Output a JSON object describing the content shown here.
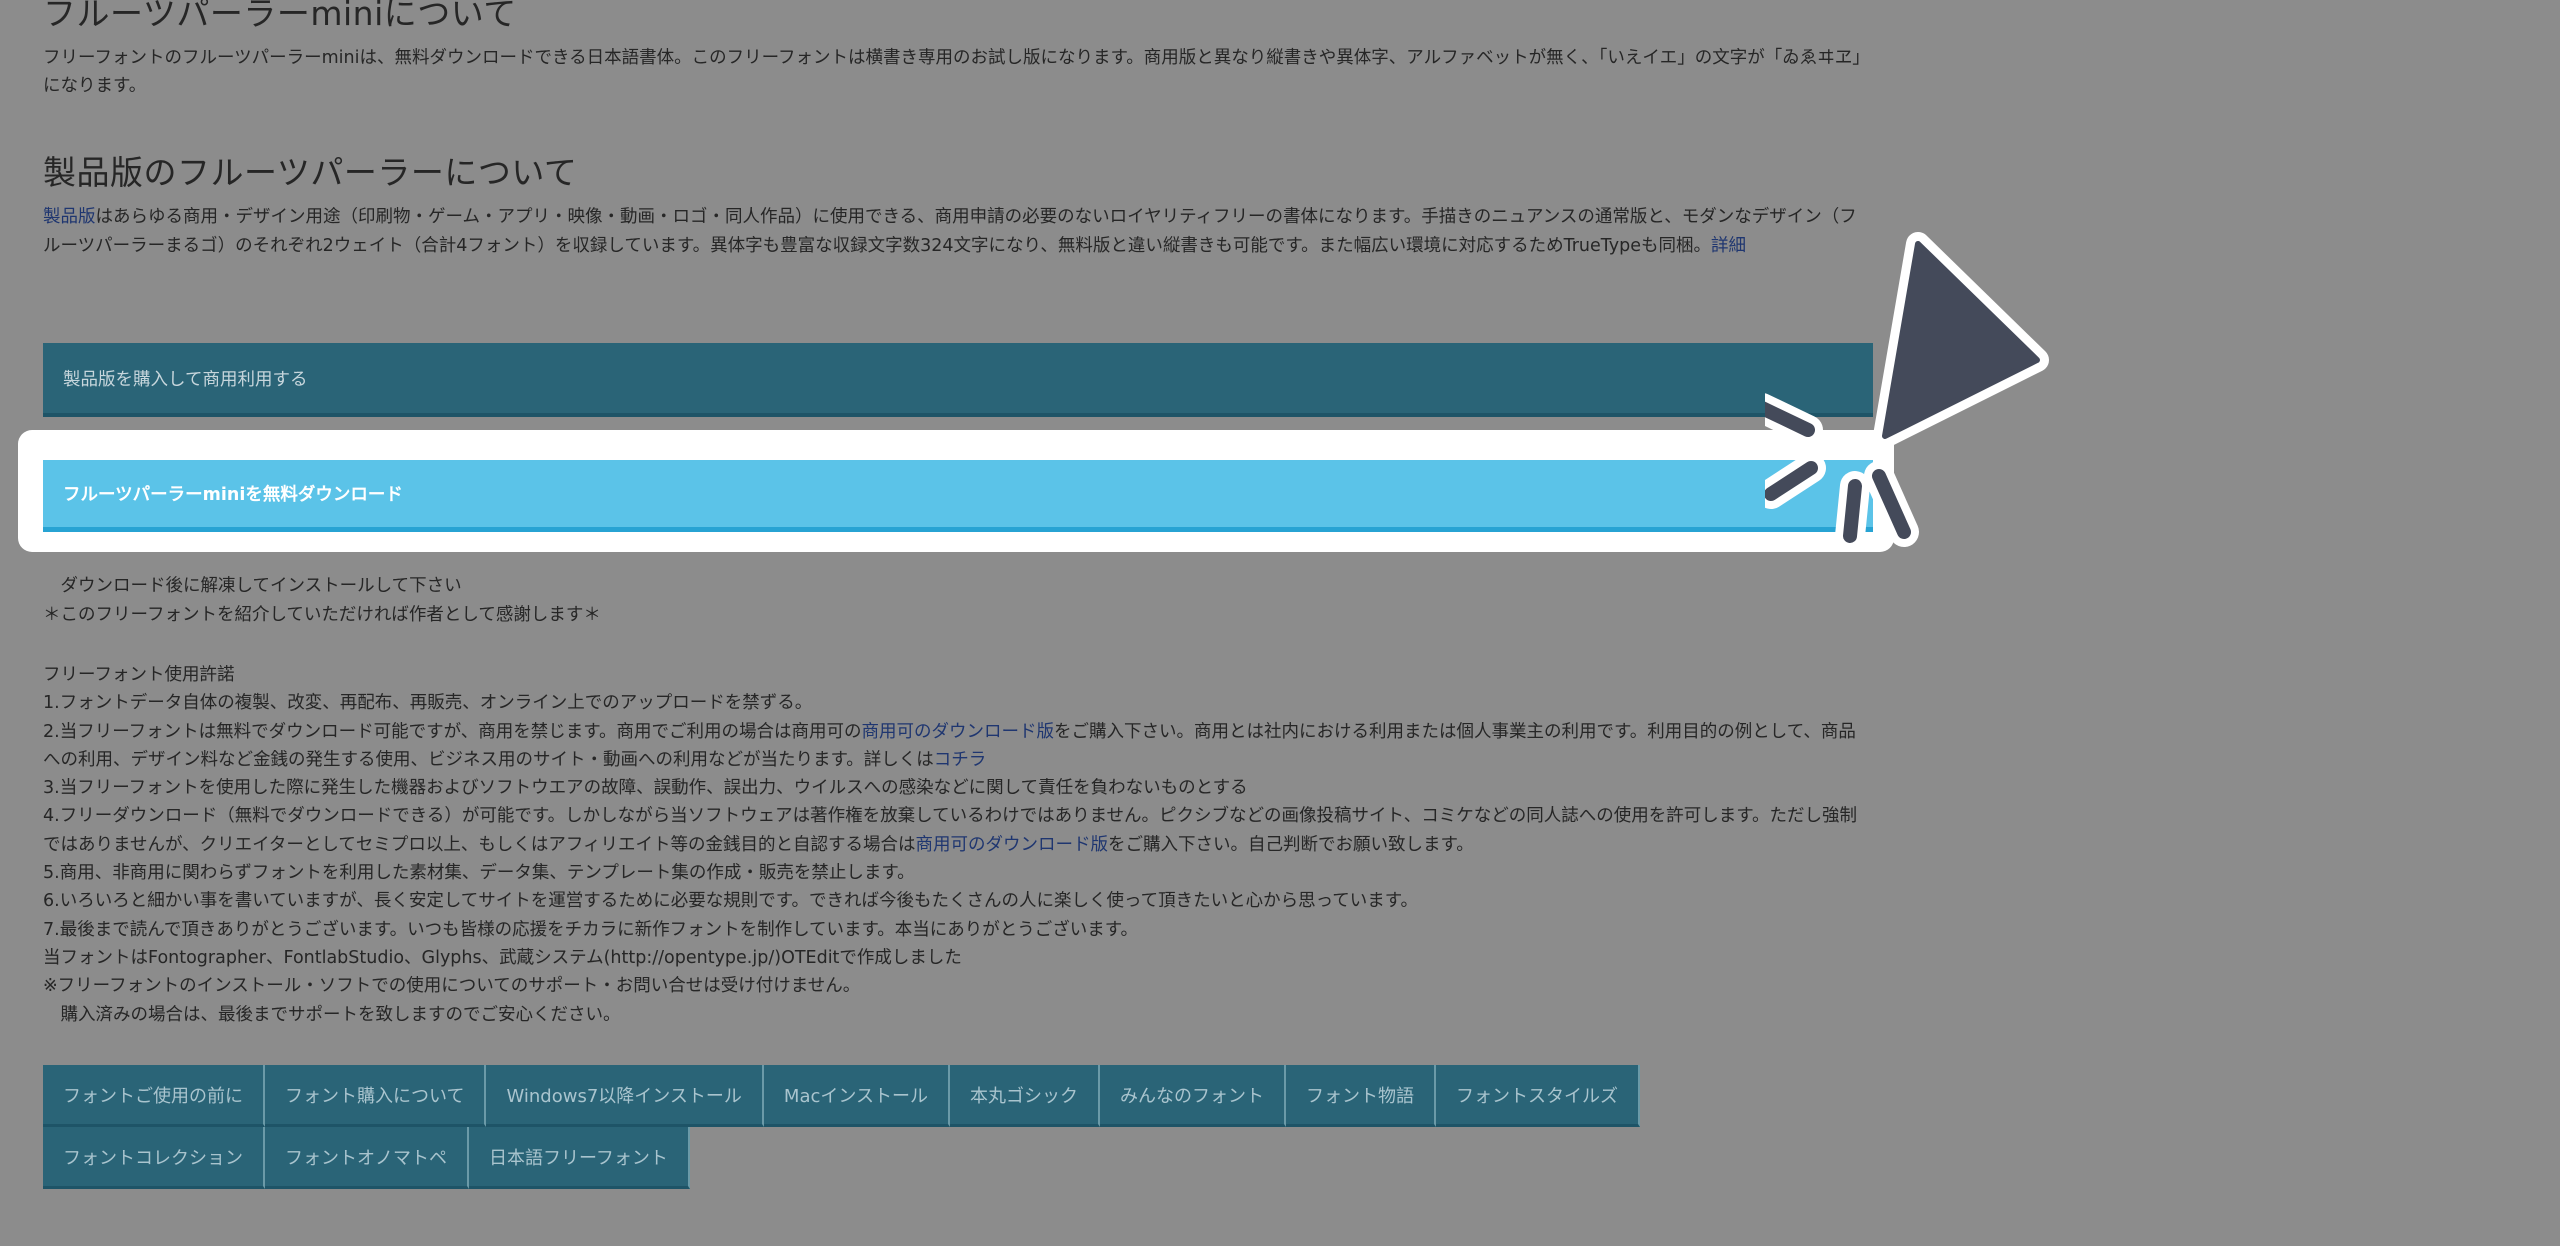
{
  "mini_section": {
    "heading": "フルーツパーラーminiについて",
    "body": "フリーフォントのフルーツパーラーminiは、無料ダウンロードできる日本語書体。このフリーフォントは横書き専用のお試し版になります。商用版と異なり縦書きや異体字、アルファベットが無く、「いえイエ」の文字が「ゐゑヰヱ」になります。"
  },
  "product_section": {
    "heading": "製品版のフルーツパーラーについて",
    "link_product": "製品版",
    "body": "はあらゆる商用・デザイン用途（印刷物・ゲーム・アプリ・映像・動画・ロゴ・同人作品）に使用できる、商用申請の必要のないロイヤリティフリーの書体になります。手描きのニュアンスの通常版と、モダンなデザイン（フルーツパーラーまるゴ）のそれぞれ2ウェイト（合計4フォント）を収録しています。異体字も豊富な収録文字数324文字になり、無料版と違い縦書きも可能です。また幅広い環境に対応するためTrueTypeも同梱。",
    "link_detail": "詳細"
  },
  "buttons": {
    "buy": "製品版を購入して商用利用する",
    "download": "フルーツパーラーminiを無料ダウンロード"
  },
  "notes": {
    "line1": "　ダウンロード後に解凍してインストールして下さい",
    "line2": "＊このフリーフォントを紹介していただければ作者として感謝します＊"
  },
  "license": {
    "title": "フリーフォント使用許諾",
    "item1": "1.フォントデータ自体の複製、改変、再配布、再販売、オンライン上でのアップロードを禁ずる。",
    "item2_a": "2.当フリーフォントは無料でダウンロード可能ですが、商用を禁じます。商用でご利用の場合は商用可の",
    "item2_link1": "商用可のダウンロード版",
    "item2_b": "をご購入下さい。商用とは社内における利用または個人事業主の利用です。利用目的の例として、商品への利用、デザイン料など金銭の発生する使用、ビジネス用のサイト・動画への利用などが当たります。詳しくは",
    "item2_link2": "コチラ",
    "item3": "3.当フリーフォントを使用した際に発生した機器およびソフトウエアの故障、誤動作、誤出力、ウイルスへの感染などに関して責任を負わないものとする",
    "item4_a": "4.フリーダウンロード（無料でダウンロードできる）が可能です。しかしながら当ソフトウェアは著作権を放棄しているわけではありません。ピクシブなどの画像投稿サイト、コミケなどの同人誌への使用を許可します。ただし強制ではありませんが、クリエイターとしてセミプロ以上、もしくはアフィリエイト等の金銭目的と自認する場合は",
    "item4_link": "商用可のダウンロード版",
    "item4_b": "をご購入下さい。自己判断でお願い致します。",
    "item5": "5.商用、非商用に関わらずフォントを利用した素材集、データ集、テンプレート集の作成・販売を禁止します。",
    "item6": "6.いろいろと細かい事を書いていますが、長く安定してサイトを運営するために必要な規則です。できれば今後もたくさんの人に楽しく使って頂きたいと心から思っています。",
    "item7": "7.最後まで読んで頂きありがとうございます。いつも皆様の応援をチカラに新作フォントを制作しています。本当にありがとうございます。",
    "made_with": "当フォントはFontographer、FontlabStudio、Glyphs、武蔵システム(http://opentype.jp/)OTEditで作成しました",
    "support_note": "※フリーフォントのインストール・ソフトでの使用についてのサポート・お問い合せは受け付けません。",
    "purchased_note": "　購入済みの場合は、最後までサポートを致しますのでご安心ください。"
  },
  "nav": {
    "items": [
      "フォントご使用の前に",
      "フォント購入について",
      "Windows7以降インストール",
      "Macインストール",
      "本丸ゴシック",
      "みんなのフォント",
      "フォント物語",
      "フォントスタイルズ",
      "フォントコレクション",
      "フォントオノマトペ",
      "日本語フリーフォント"
    ]
  },
  "colors": {
    "overlay_gray": "#8c8c8c",
    "bar_dark": "#2a6477",
    "download_highlight": "#5bc3e8",
    "cursor_fill": "#444a5a"
  },
  "icons": {
    "cursor": "pointer-arrow-click-icon"
  }
}
